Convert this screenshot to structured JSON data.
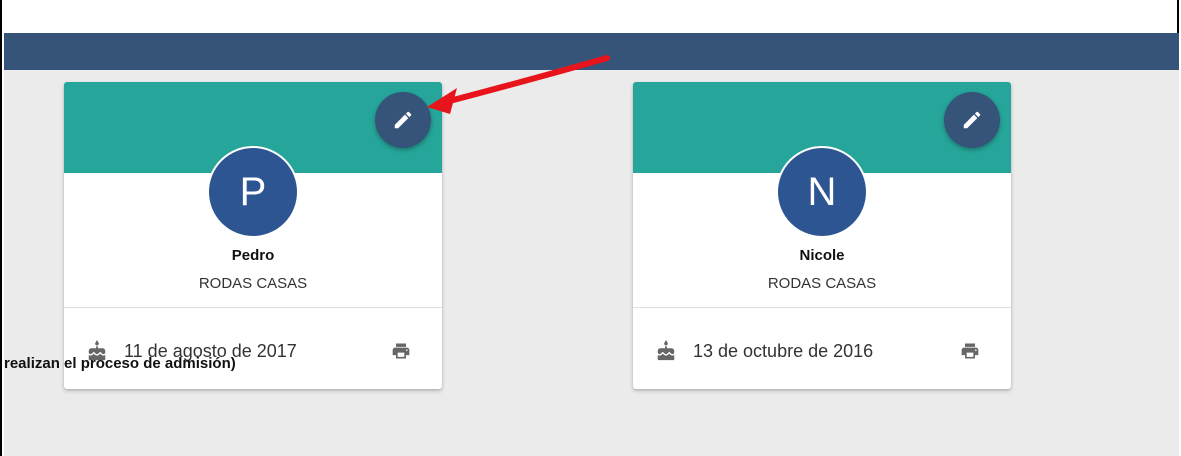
{
  "cards": [
    {
      "initial": "P",
      "first_name": "Pedro",
      "last_name": "RODAS CASAS",
      "birth_date": "11 de agosto de 2017"
    },
    {
      "initial": "N",
      "first_name": "Nicole",
      "last_name": "RODAS CASAS",
      "birth_date": "13 de octubre de 2016"
    }
  ],
  "section_text": "realizan el proceso de admisión)",
  "colors": {
    "topbar": "#36537a",
    "card_header": "#26a69a",
    "avatar": "#2c5592",
    "edit_button": "#36537a",
    "annotation_arrow": "#e8141b"
  },
  "icons": {
    "edit": "pencil-icon",
    "birthday": "cake-icon",
    "print": "printer-icon"
  }
}
